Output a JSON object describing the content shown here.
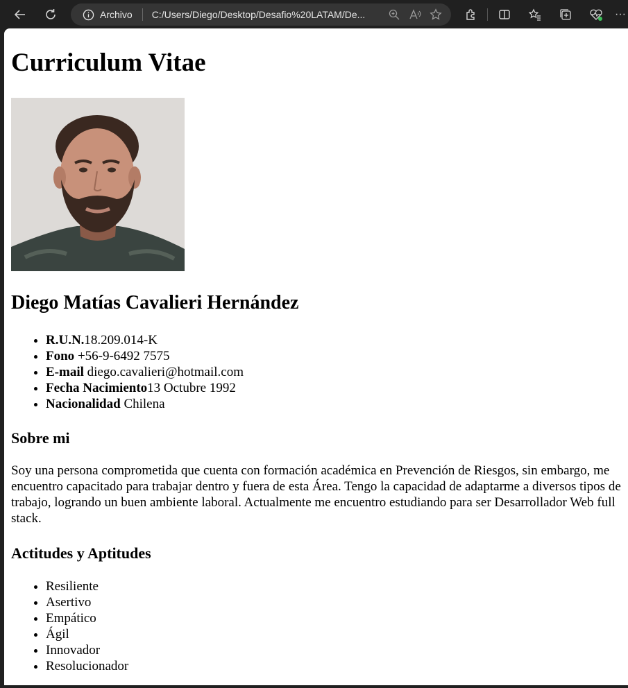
{
  "browser": {
    "site_info_label": "Archivo",
    "url": "C:/Users/Diego/Desktop/Desafio%20LATAM/De...",
    "more_label": "···"
  },
  "page": {
    "title": "Curriculum Vitae",
    "name": "Diego Matías Cavalieri Hernández",
    "info": [
      {
        "label": "R.U.N.",
        "value": "18.209.014-K"
      },
      {
        "label": "Fono",
        "value": " +56-9-6492 7575"
      },
      {
        "label": "E-mail",
        "value": " diego.cavalieri@hotmail.com"
      },
      {
        "label": "Fecha Nacimiento",
        "value": "13 Octubre 1992"
      },
      {
        "label": "Nacionalidad",
        "value": " Chilena"
      }
    ],
    "sobre_heading": "Sobre mi",
    "sobre_text": "Soy una persona comprometida que cuenta con formación académica en Prevención de Riesgos, sin embargo, me encuentro capacitado para trabajar dentro y fuera de esta Área. Tengo la capacidad de adaptarme a diversos tipos de trabajo, logrando un buen ambiente laboral. Actualmente me encuentro estudiando para ser Desarrollador Web full stack.",
    "aptitudes_heading": "Actitudes y Aptitudes",
    "aptitudes": [
      "Resiliente",
      "Asertivo",
      "Empático",
      "Ágil",
      "Innovador",
      "Resolucionador"
    ]
  },
  "colors": {
    "chrome_bg": "#202020",
    "address_bg": "#353535",
    "page_bg": "#ffffff",
    "text": "#000000"
  }
}
